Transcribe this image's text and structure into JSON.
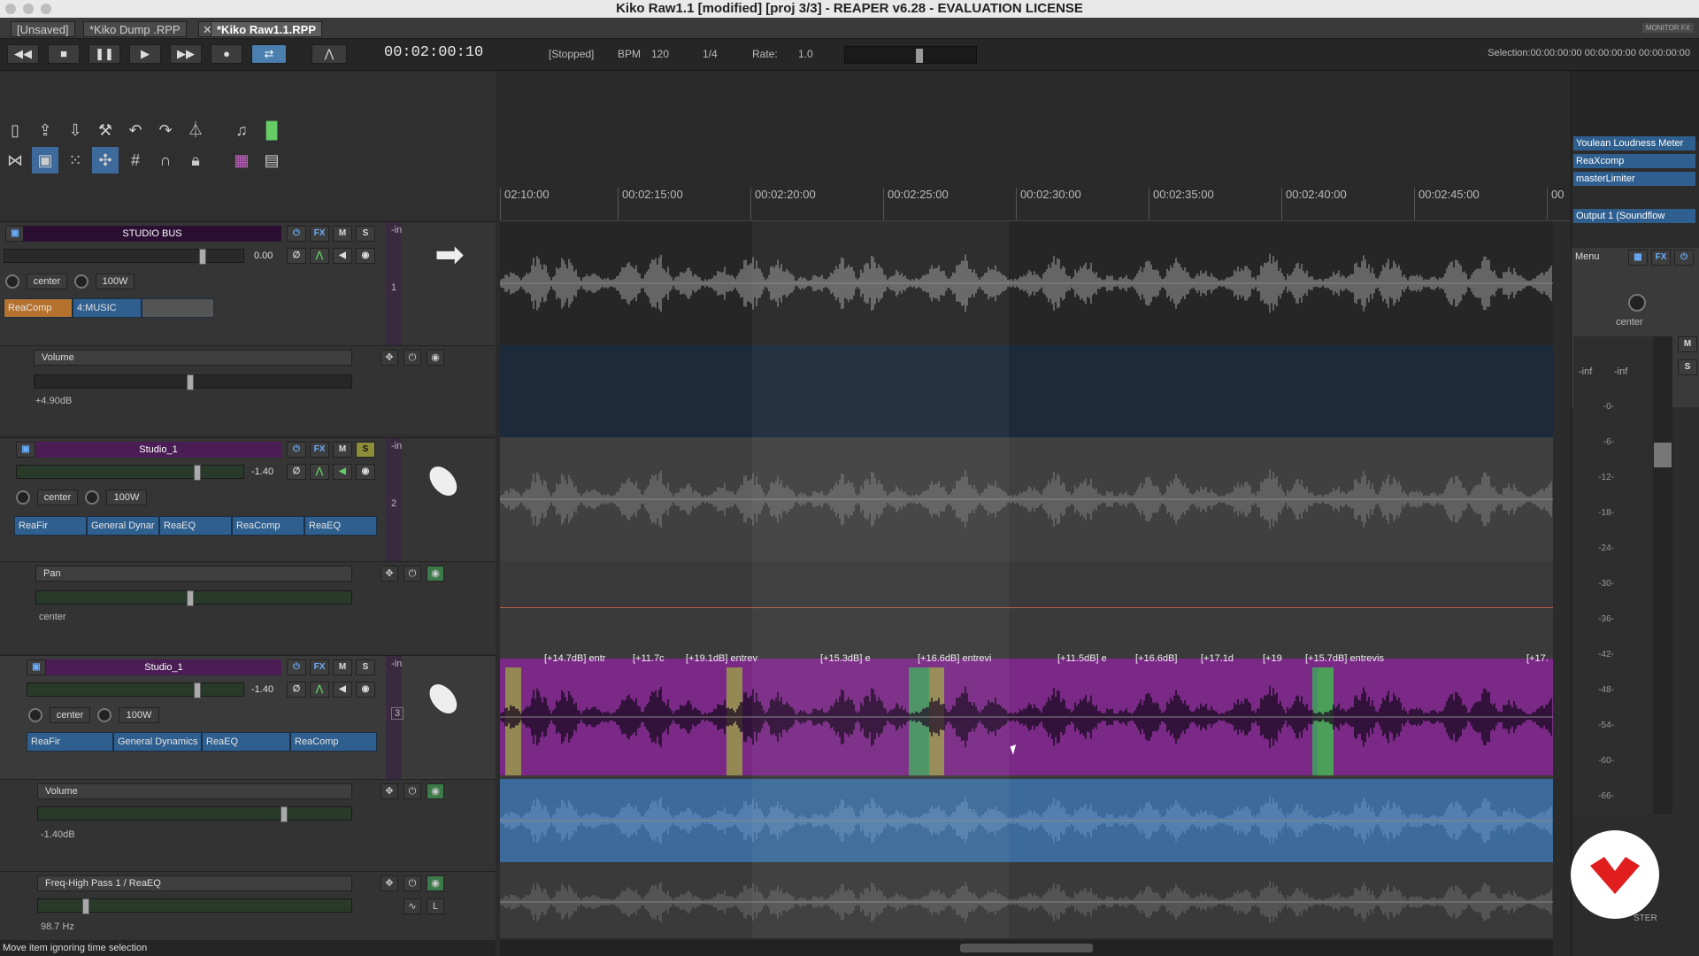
{
  "window": {
    "title": "Kiko Raw1.1 [modified] [proj 3/3] - REAPER v6.28 - EVALUATION LICENSE"
  },
  "tabs": [
    {
      "label": "[Unsaved]"
    },
    {
      "label": "*Kiko Dump .RPP"
    },
    {
      "label": "*Kiko Raw1.1.RPP"
    }
  ],
  "tab_close": "✕",
  "monitor_fx": "MONITOR FX",
  "transport": {
    "time": "00:02:00:10",
    "state": "[Stopped]",
    "bpm_label": "BPM",
    "bpm": "120",
    "timesig": "1/4",
    "rate_label": "Rate:",
    "rate": "1.0",
    "rate_level": 0.56,
    "selection": "Selection:00:00:00:00 00:00:00:00 00:00:00:00"
  },
  "ruler": {
    "ticks": [
      "02:10:00",
      "00:02:15:00",
      "00:02:20:00",
      "00:02:25:00",
      "00:02:30:00",
      "00:02:35:00",
      "00:02:40:00",
      "00:02:45:00",
      "00"
    ]
  },
  "tracks": [
    {
      "name": "STUDIO BUS",
      "number": "1",
      "in_label": "-in",
      "volume": "0.00",
      "pan": "center",
      "width": "100W",
      "fx": [
        "ReaComp",
        "4:MUSIC"
      ],
      "envelope": {
        "name": "Volume",
        "value": "+4.90dB"
      }
    },
    {
      "name": "Studio_1",
      "number": "2",
      "in_label": "-in",
      "volume": "-1.40",
      "pan": "center",
      "width": "100W",
      "fx": [
        "ReaFir",
        "General Dynar",
        "ReaEQ",
        "ReaComp",
        "ReaEQ"
      ],
      "envelope": {
        "name": "Pan",
        "value": "center"
      }
    },
    {
      "name": "Studio_1",
      "number": "3",
      "in_label": "-in",
      "volume": "-1.40",
      "pan": "center",
      "width": "100W",
      "fx": [
        "ReaFir",
        "General Dynamics",
        "ReaEQ",
        "ReaComp"
      ],
      "envelope": {
        "name": "Volume",
        "value": "-1.40dB"
      },
      "envelope2": {
        "name": "Freq-High Pass 1 / ReaEQ",
        "value": "98.7 Hz"
      }
    }
  ],
  "item_labels": [
    "[+14.7dB] entr",
    "[+11.7c",
    "[+19.1dB] entrev",
    "[+15.3dB] e",
    "[+16.6dB] entrevi",
    "[+11.5dB] e",
    "[+16.6dB]",
    "[+17.1d",
    "[+19",
    "[+15.7dB] entrevis",
    "[+17."
  ],
  "buttons": {
    "fx": "FX",
    "m": "M",
    "s": "S",
    "l": "L"
  },
  "master": {
    "fx": [
      "Youlean Loudness Meter",
      "ReaXcomp",
      "masterLimiter"
    ],
    "output": "Output 1 (Soundflow",
    "menu": "Menu",
    "pan": "center",
    "peak_l": "-inf",
    "peak_r": "-inf",
    "scale": [
      "-0-",
      "-6-",
      "-12-",
      "-18-",
      "-24-",
      "-30-",
      "-36-",
      "-42-",
      "-48-",
      "-54-",
      "-60-",
      "-66-"
    ],
    "label": "STER"
  },
  "status": "Move item ignoring time selection",
  "colors": {
    "track_purple": "#4a1e55",
    "item_purple": "#7a2a86",
    "fx_blue": "#2f5f8f",
    "selection_yellow": "#9a9a4a",
    "selection_green": "#3fa35a",
    "logo_red": "#e01e1e"
  }
}
